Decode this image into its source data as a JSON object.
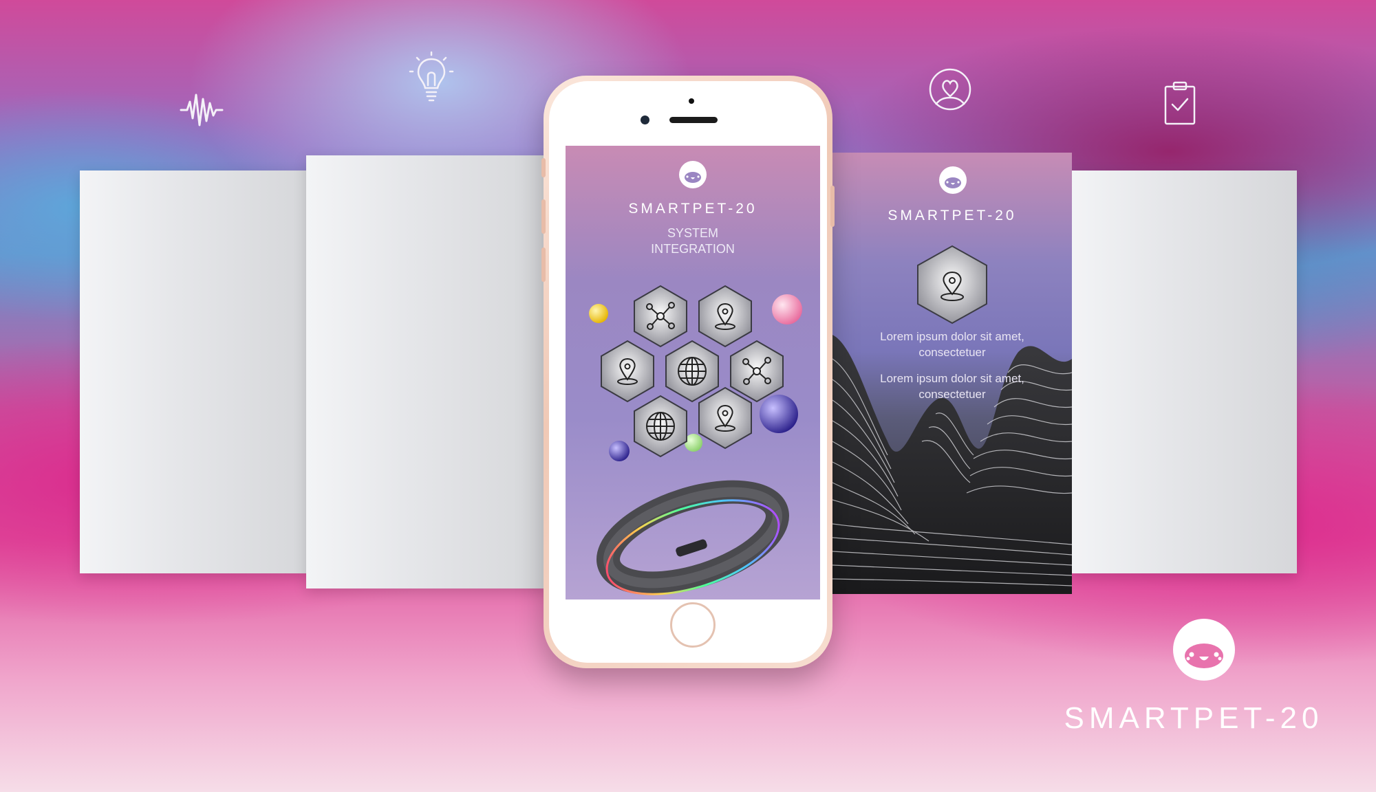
{
  "brand": {
    "name": "SMARTPET-20"
  },
  "screen1": {
    "title": "SMARTPET-20",
    "subtitle_line1": "SYSTEM",
    "subtitle_line2": "INTEGRATION"
  },
  "screen2": {
    "title": "SMARTPET-20",
    "text1_line1": "Lorem ipsum dolor sit amet,",
    "text1_line2": "consectetuer",
    "text2_line1": "Lorem ipsum dolor sit amet,",
    "text2_line2": "consectetuer"
  },
  "top_icons": [
    "soundwave-icon",
    "lightbulb-icon",
    "user-heart-icon",
    "clipboard-check-icon"
  ],
  "hex_icons": [
    "network-icon",
    "location-pin-icon",
    "location-pin-icon",
    "globe-icon",
    "network-icon",
    "globe-icon",
    "location-pin-icon"
  ],
  "colors": {
    "accent_pink": "#e0549e",
    "screen_purple": "#9a8cc9",
    "phone_rose_gold": "#f0c9b6"
  }
}
